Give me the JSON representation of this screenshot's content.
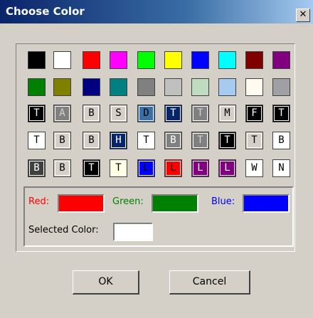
{
  "window": {
    "title": "Choose Color",
    "close_glyph": "✕",
    "close_icon": "close-icon"
  },
  "palette": {
    "rows": [
      [
        {
          "bg": "#000000",
          "fg": "",
          "t": ""
        },
        {
          "bg": "#ffffff",
          "fg": "",
          "t": ""
        },
        {
          "bg": "#ff0000",
          "fg": "",
          "t": ""
        },
        {
          "bg": "#ff00ff",
          "fg": "",
          "t": ""
        },
        {
          "bg": "#00ff00",
          "fg": "",
          "t": ""
        },
        {
          "bg": "#ffff00",
          "fg": "",
          "t": ""
        },
        {
          "bg": "#0000ff",
          "fg": "",
          "t": ""
        },
        {
          "bg": "#00ffff",
          "fg": "",
          "t": ""
        },
        {
          "bg": "#800000",
          "fg": "",
          "t": ""
        },
        {
          "bg": "#800080",
          "fg": "",
          "t": ""
        }
      ],
      [
        {
          "bg": "#008000",
          "fg": "",
          "t": ""
        },
        {
          "bg": "#808000",
          "fg": "",
          "t": ""
        },
        {
          "bg": "#000080",
          "fg": "",
          "t": ""
        },
        {
          "bg": "#008080",
          "fg": "",
          "t": ""
        },
        {
          "bg": "#808080",
          "fg": "",
          "t": ""
        },
        {
          "bg": "#c0c0c0",
          "fg": "",
          "t": ""
        },
        {
          "bg": "#c0dcc0",
          "fg": "",
          "t": ""
        },
        {
          "bg": "#a6caf0",
          "fg": "",
          "t": ""
        },
        {
          "bg": "#fffbf0",
          "fg": "",
          "t": ""
        },
        {
          "bg": "#a0a0a4",
          "fg": "",
          "t": ""
        }
      ],
      [
        {
          "bg": "#000000",
          "fg": "#ffffff",
          "t": "T"
        },
        {
          "bg": "#808080",
          "fg": "#d4d0c8",
          "t": "A"
        },
        {
          "bg": "#d4d0c8",
          "fg": "#000000",
          "t": "B"
        },
        {
          "bg": "#d4d0c8",
          "fg": "#000000",
          "t": "S"
        },
        {
          "bg": "#3a6ea5",
          "fg": "#000000",
          "t": "D"
        },
        {
          "bg": "#0a246a",
          "fg": "#ffffff",
          "t": "T"
        },
        {
          "bg": "#808080",
          "fg": "#d4d0c8",
          "t": "T"
        },
        {
          "bg": "#d4d0c8",
          "fg": "#000000",
          "t": "M"
        },
        {
          "bg": "#000000",
          "fg": "#ffffff",
          "t": "F"
        },
        {
          "bg": "#000000",
          "fg": "#ffffff",
          "t": "T"
        }
      ],
      [
        {
          "bg": "#ffffff",
          "fg": "#000000",
          "t": "T"
        },
        {
          "bg": "#d4d0c8",
          "fg": "#000000",
          "t": "B"
        },
        {
          "bg": "#d4d0c8",
          "fg": "#000000",
          "t": "B"
        },
        {
          "bg": "#0a246a",
          "fg": "#ffffff",
          "t": "H"
        },
        {
          "bg": "#ffffff",
          "fg": "#000000",
          "t": "T"
        },
        {
          "bg": "#808080",
          "fg": "#ffffff",
          "t": "B"
        },
        {
          "bg": "#808080",
          "fg": "#d4d0c8",
          "t": "T"
        },
        {
          "bg": "#000000",
          "fg": "#ffffff",
          "t": "T"
        },
        {
          "bg": "#d4d0c8",
          "fg": "#000000",
          "t": "T"
        },
        {
          "bg": "#ffffff",
          "fg": "#000000",
          "t": "B"
        }
      ],
      [
        {
          "bg": "#404040",
          "fg": "#ffffff",
          "t": "B"
        },
        {
          "bg": "#d4d0c8",
          "fg": "#000000",
          "t": "B"
        },
        {
          "bg": "#000000",
          "fg": "#ffffff",
          "t": "T"
        },
        {
          "bg": "#ffffe1",
          "fg": "#000000",
          "t": "T"
        },
        {
          "bg": "#0000ff",
          "fg": "#000000",
          "t": "L"
        },
        {
          "bg": "#ff0000",
          "fg": "#000000",
          "t": "L"
        },
        {
          "bg": "#800080",
          "fg": "#ffffff",
          "t": "L"
        },
        {
          "bg": "#800080",
          "fg": "#ffffff",
          "t": "L"
        },
        {
          "bg": "#ffffff",
          "fg": "#000000",
          "t": "W"
        },
        {
          "bg": "#ffffff",
          "fg": "#000000",
          "t": "N"
        }
      ]
    ]
  },
  "custom": {
    "red_label": "Red:",
    "red_color": "#ff0000",
    "green_label": "Green:",
    "green_color": "#008000",
    "blue_label": "Blue:",
    "blue_color": "#0000ff",
    "selected_label": "Selected Color:",
    "selected_color": "#ffffff"
  },
  "buttons": {
    "ok": "OK",
    "cancel": "Cancel"
  }
}
